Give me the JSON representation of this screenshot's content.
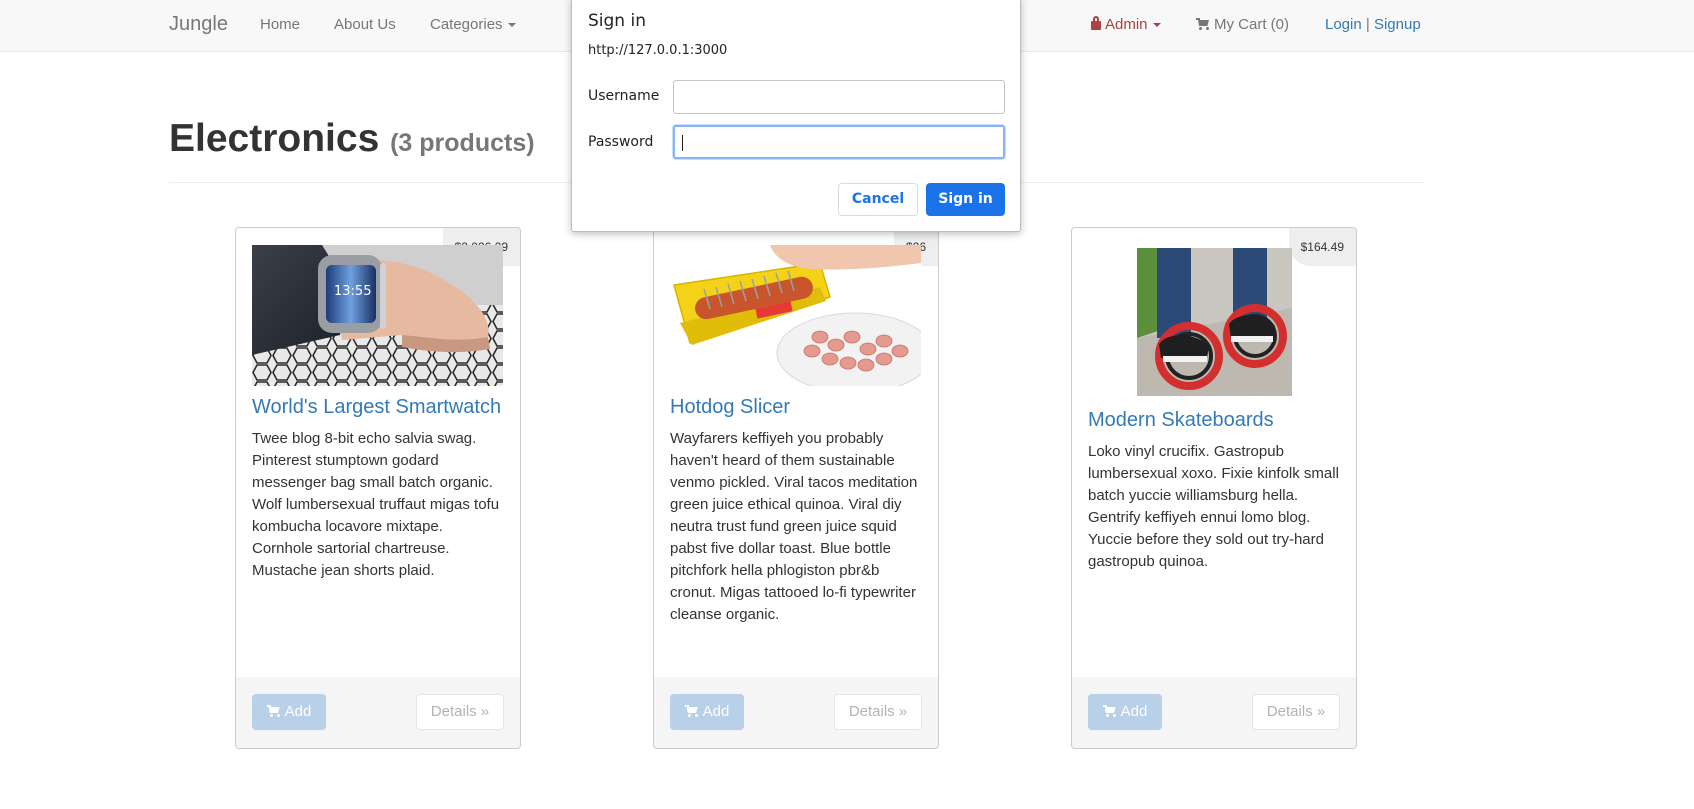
{
  "navbar": {
    "brand": "Jungle",
    "home": "Home",
    "about": "About Us",
    "categories": "Categories",
    "admin": "Admin",
    "cart": "My Cart (0)",
    "login": "Login",
    "separator": "|",
    "signup": "Signup"
  },
  "page": {
    "title": "Electronics",
    "count": "(3 products)"
  },
  "products": [
    {
      "price": "$2,026.29",
      "name": "World's Largest Smartwatch",
      "description": "Twee blog 8-bit echo salvia swag. Pinterest stumptown godard messenger bag small batch organic. Wolf lumbersexual truffaut migas tofu kombucha locavore mixtape. Cornhole sartorial chartreuse. Mustache jean shorts plaid.",
      "add_label": "Add",
      "details_label": "Details »",
      "image_icon": "smartwatch-photo"
    },
    {
      "price": "$26",
      "name": "Hotdog Slicer",
      "description": "Wayfarers keffiyeh you probably haven't heard of them sustainable venmo pickled. Viral tacos meditation green juice ethical quinoa. Viral diy neutra trust fund green juice squid pabst five dollar toast. Blue bottle pitchfork hella phlogiston pbr&b cronut. Migas tattooed lo-fi typewriter cleanse organic.",
      "add_label": "Add",
      "details_label": "Details »",
      "image_icon": "hotdog-slicer-photo"
    },
    {
      "price": "$164.49",
      "name": "Modern Skateboards",
      "description": "Loko vinyl crucifix. Gastropub lumbersexual xoxo. Fixie kinfolk small batch yuccie williamsburg hella. Gentrify keffiyeh ennui lomo blog. Yuccie before they sold out try-hard gastropub quinoa.",
      "add_label": "Add",
      "details_label": "Details »",
      "image_icon": "skateboards-photo"
    }
  ],
  "dialog": {
    "title": "Sign in",
    "url": "http://127.0.0.1:3000",
    "username_label": "Username",
    "username_value": "",
    "password_label": "Password",
    "password_value": "",
    "cancel": "Cancel",
    "signin": "Sign in"
  },
  "colors": {
    "link": "#337ab7",
    "admin": "#a94442",
    "dialog_primary": "#1a73e8",
    "add_button": "#b8d1e8"
  }
}
